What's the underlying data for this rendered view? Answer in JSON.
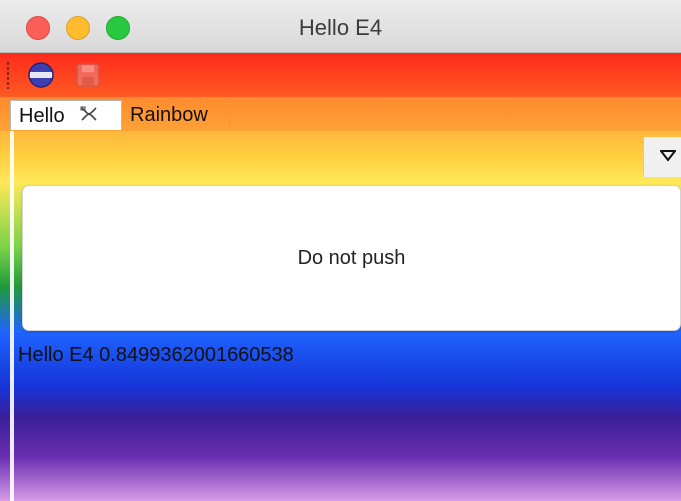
{
  "window": {
    "title": "Hello E4"
  },
  "toolbar": {
    "items": [
      {
        "icon": "globe-icon"
      },
      {
        "icon": "save-icon",
        "enabled": false
      }
    ]
  },
  "tabs": [
    {
      "label": "Hello",
      "active": true,
      "closable": true
    },
    {
      "label": "Rainbow",
      "active": false
    }
  ],
  "view_menu": {
    "icon": "chevron-down-icon"
  },
  "content": {
    "button_label": "Do not push",
    "status_text": "Hello E4 0.8499362001660538"
  },
  "colors": {
    "close": "#fc5f57",
    "minimize": "#fdbc2e",
    "maximize": "#28c840"
  }
}
